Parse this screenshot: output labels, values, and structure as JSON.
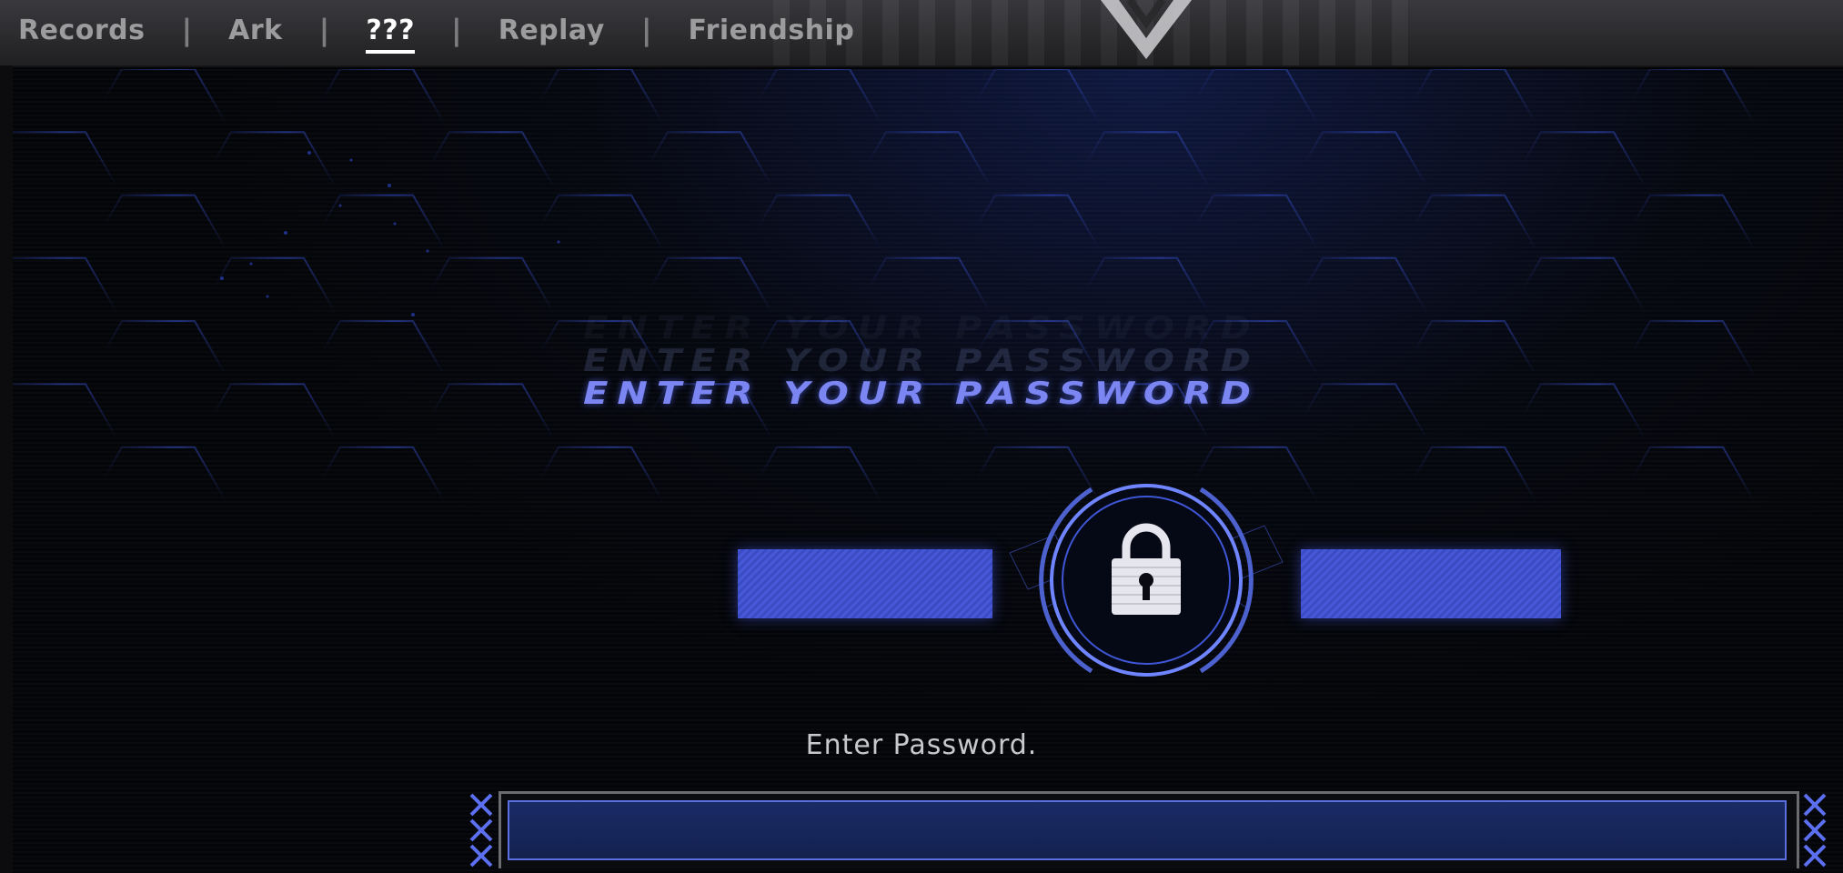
{
  "nav": {
    "tabs": [
      {
        "label": "Records"
      },
      {
        "label": "Ark"
      },
      {
        "label": "???"
      },
      {
        "label": "Replay"
      },
      {
        "label": "Friendship"
      }
    ],
    "active_index": 2
  },
  "panel": {
    "title": "ENTER YOUR PASSWORD",
    "hint": "Enter Password.",
    "lock_icon": "padlock-icon"
  },
  "password_input": {
    "value": "",
    "placeholder": ""
  },
  "colors": {
    "accent": "#4658d8",
    "title": "#7b86f2",
    "background": "#040508"
  }
}
